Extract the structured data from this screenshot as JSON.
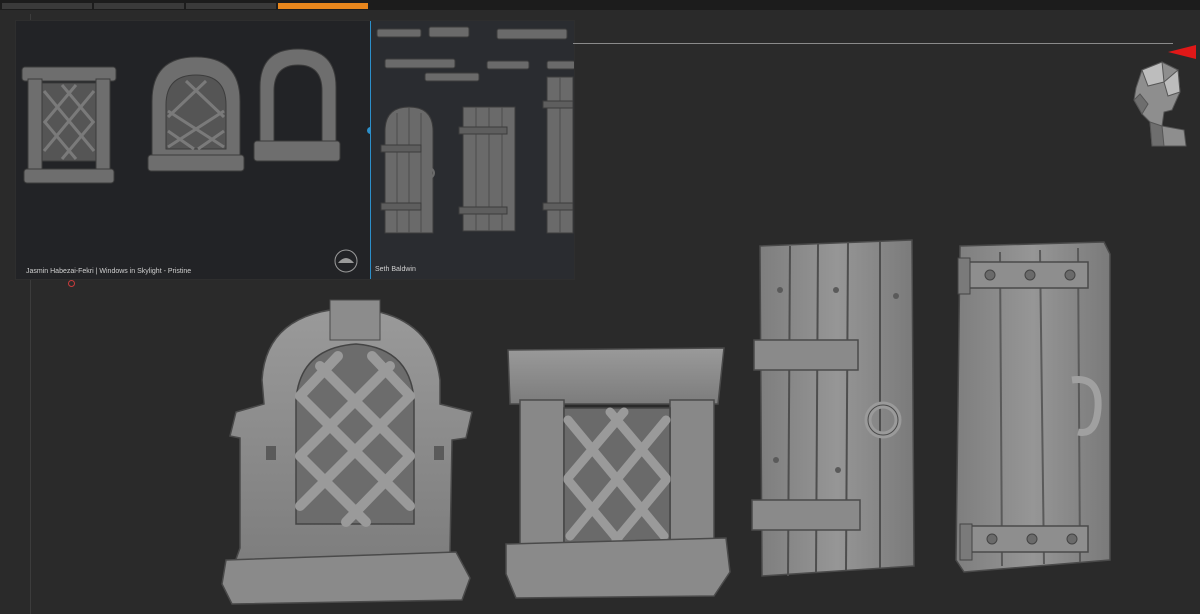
{
  "tabs": [
    {
      "label": "",
      "active": false
    },
    {
      "label": "",
      "active": false
    },
    {
      "label": "",
      "active": false
    },
    {
      "label": "",
      "active": true
    }
  ],
  "reference_panel": {
    "left_caption": "Jasmin Habezai-Fekri  |  Windows in Skylight - Pristine",
    "right_caption": "Seth Baldwin"
  },
  "colors": {
    "accent": "#e8861c",
    "divider": "#2c8fc9",
    "background": "#2a2a2a",
    "clay": "#8c8c8c"
  },
  "icons": {
    "orientation": "head-orientation-icon",
    "red_marker": "red-triangle-marker-icon"
  }
}
